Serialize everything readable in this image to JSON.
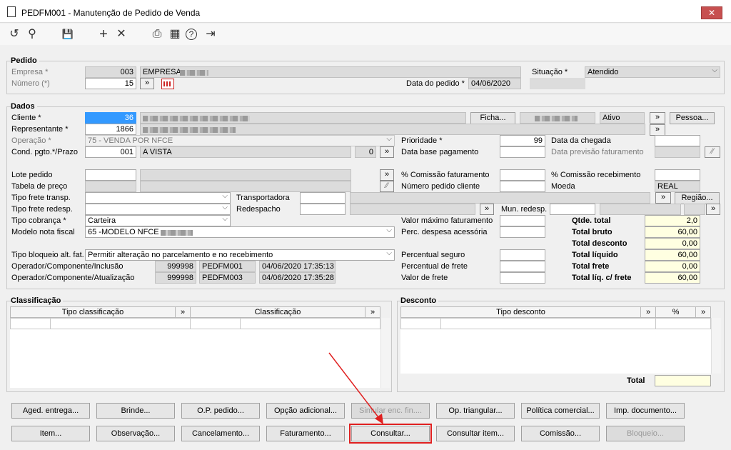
{
  "window": {
    "title": "PEDFM001 - Manutenção de Pedido de Venda",
    "close": "✕"
  },
  "toolbar": {
    "undo": "↺",
    "search": "⚲",
    "save": "💾",
    "add": "+",
    "remove": "✕",
    "print": "⎙",
    "calendar": "▦",
    "help": "?",
    "exit": "⇥"
  },
  "pedido": {
    "section": "Pedido",
    "empresa_label": "Empresa *",
    "empresa_code": "003",
    "empresa_name": "EMPRESA",
    "numero_label": "Número (*)",
    "numero_value": "15",
    "data_label": "Data do pedido *",
    "data_value": "04/06/2020",
    "situacao_label": "Situação *",
    "situacao_value": "Atendido"
  },
  "dados": {
    "section": "Dados",
    "cliente_label": "Cliente *",
    "cliente_code": "36",
    "ficha_btn": "Ficha...",
    "status": "Ativo",
    "pessoa_btn": "Pessoa...",
    "representante_label": "Representante *",
    "representante_code": "1866",
    "operacao_label": "Operação *",
    "operacao_value": "75 - VENDA POR NFCE",
    "prioridade_label": "Prioridade *",
    "prioridade_value": "99",
    "data_chegada_label": "Data da chegada",
    "cond_label": "Cond. pgto.*/Prazo",
    "cond_code": "001",
    "cond_name": "A VISTA",
    "prazo": "0",
    "data_base_label": "Data base pagamento",
    "data_prev_label": "Data previsão faturamento",
    "lote_label": "Lote pedido",
    "comissao_fat_label": "% Comissão faturamento",
    "comissao_rec_label": "% Comissão recebimento",
    "tabela_label": "Tabela de preço",
    "num_pedido_cliente_label": "Número pedido cliente",
    "moeda_label": "Moeda",
    "moeda_value": "REAL",
    "frete_transp_label": "Tipo frete transp.",
    "transportadora_label": "Transportadora",
    "regiao_btn": "Região...",
    "frete_redesp_label": "Tipo frete redesp.",
    "redespacho_label": "Redespacho",
    "mun_redesp_label": "Mun. redesp.",
    "cobranca_label": "Tipo cobrança *",
    "cobranca_value": "Carteira",
    "valor_max_label": "Valor máximo faturamento",
    "modelo_label": "Modelo nota fiscal",
    "modelo_value": "65 -MODELO NFCE",
    "perc_despesa_label": "Perc. despesa acessória",
    "bloqueio_label": "Tipo bloqueio alt. fat.",
    "bloqueio_value": "Permitir alteração no parcelamento e no recebimento",
    "perc_seguro_label": "Percentual seguro",
    "perc_frete_label": "Percentual de frete",
    "valor_frete_label": "Valor de frete",
    "op_inclusao_label": "Operador/Componente/Inclusão",
    "op_inclusao_user": "999998",
    "op_inclusao_comp": "PEDFM001",
    "op_inclusao_date": "04/06/2020 17:35:13",
    "op_atual_label": "Operador/Componente/Atualização",
    "op_atual_user": "999998",
    "op_atual_comp": "PEDFM003",
    "op_atual_date": "04/06/2020 17:35:28"
  },
  "totals": {
    "qtde_label": "Qtde. total",
    "qtde": "2,0",
    "bruto_label": "Total bruto",
    "bruto": "60,00",
    "desconto_label": "Total desconto",
    "desconto": "0,00",
    "liquido_label": "Total líquido",
    "liquido": "60,00",
    "frete_label": "Total frete",
    "frete": "0,00",
    "liq_frete_label": "Total líq. c/ frete",
    "liq_frete": "60,00"
  },
  "classificacao": {
    "section": "Classificação",
    "col1": "Tipo classificação",
    "col2": "Classificação"
  },
  "desconto": {
    "section": "Desconto",
    "col1": "Tipo desconto",
    "col2": "%",
    "total_label": "Total"
  },
  "buttons": {
    "aged": "Aged. entrega...",
    "brinde": "Brinde...",
    "op_pedido": "O.P. pedido...",
    "opcao": "Opção adicional...",
    "simular": "Simular enc. fin....",
    "triangular": "Op. triangular...",
    "politica": "Política comercial...",
    "imp_doc": "Imp. documento...",
    "item": "Item...",
    "observacao": "Observação...",
    "cancelamento": "Cancelamento...",
    "faturamento": "Faturamento...",
    "consultar": "Consultar...",
    "consultar_item": "Consultar item...",
    "comissao": "Comissão...",
    "bloqueio": "Bloqueio..."
  },
  "misc": {
    "go": "»",
    "colors": {
      "highlight": "#e02020",
      "selection": "#3399ff",
      "totals_bg": "#ffffe1"
    }
  }
}
